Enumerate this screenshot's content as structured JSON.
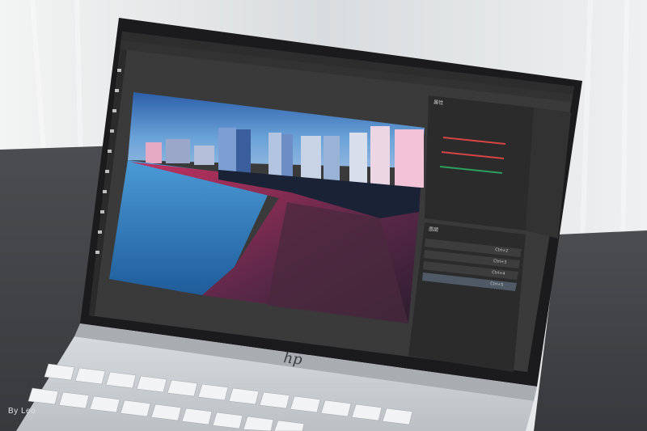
{
  "photo": {
    "subject": "hp-laptop-running-photoshop",
    "logo_text": "hp",
    "watermark": "By Leo"
  },
  "photoshop": {
    "panel_properties_title": "属性",
    "panel_layers_title": "图层",
    "layers": [
      "Ctrl+2",
      "Ctrl+3",
      "Ctrl+4",
      "Ctrl+5"
    ]
  },
  "colors": {
    "sky": "#3f7fc9",
    "water": "#3b87c6",
    "promenade": "#d43a6c",
    "ps_background": "#3a3a3a",
    "ps_panel": "#2b2b2b",
    "bezel": "#1b1b1d",
    "laptop_silver": "#c9cdd1"
  }
}
